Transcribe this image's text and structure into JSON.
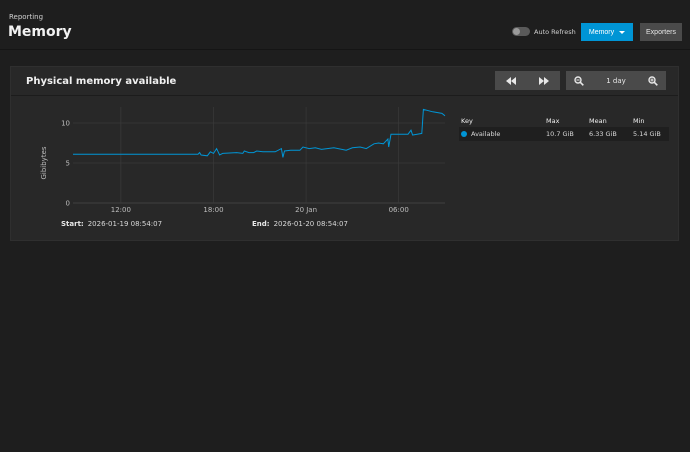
{
  "header": {
    "breadcrumb": "Reporting",
    "title": "Memory",
    "auto_refresh_label": "Auto Refresh",
    "auto_refresh_on": false,
    "memory_button": "Memory",
    "exporters_button": "Exporters"
  },
  "card": {
    "title": "Physical memory available",
    "prev_icon": "rewind-icon",
    "next_icon": "fast-forward-icon",
    "zoom_out_icon": "zoom-out-icon",
    "zoom_in_icon": "zoom-in-icon",
    "range_label": "1 day",
    "start_label": "Start:",
    "start_value": "2026-01-19 08:54:07",
    "end_label": "End:",
    "end_value": "2026-01-20 08:54:07"
  },
  "legend": {
    "headers": [
      "Key",
      "Max",
      "Mean",
      "Min"
    ],
    "rows": [
      {
        "key": "Available",
        "max": "10.7 GiB",
        "mean": "6.33 GiB",
        "min": "5.14 GiB",
        "color": "#0095d5"
      }
    ]
  },
  "colors": {
    "accent": "#0095d5",
    "background": "#1e1e1e",
    "card": "#282828"
  },
  "chart_data": {
    "type": "line",
    "ylabel": "Gibibytes",
    "ylim": [
      0,
      12
    ],
    "yticks": [
      "0",
      "5",
      "10"
    ],
    "xticks": [
      "12:00",
      "18:00",
      "20 Jan",
      "06:00"
    ],
    "xlim_hours": [
      8.9,
      33.0
    ],
    "grid": true,
    "series": [
      {
        "name": "Available",
        "color": "#0095d5",
        "points": [
          [
            8.9,
            6.1
          ],
          [
            11.0,
            6.1
          ],
          [
            14.0,
            6.1
          ],
          [
            16.5,
            6.1
          ],
          [
            17.0,
            6.1
          ],
          [
            17.1,
            6.3
          ],
          [
            17.2,
            6.0
          ],
          [
            17.6,
            5.9
          ],
          [
            17.8,
            6.4
          ],
          [
            18.0,
            6.2
          ],
          [
            18.2,
            6.8
          ],
          [
            18.4,
            6.0
          ],
          [
            18.6,
            6.2
          ],
          [
            19.5,
            6.3
          ],
          [
            19.9,
            6.2
          ],
          [
            20.0,
            6.5
          ],
          [
            20.3,
            6.3
          ],
          [
            20.6,
            6.3
          ],
          [
            20.8,
            6.5
          ],
          [
            21.2,
            6.4
          ],
          [
            22.0,
            6.4
          ],
          [
            22.4,
            6.8
          ],
          [
            22.5,
            5.7
          ],
          [
            22.6,
            6.5
          ],
          [
            23.0,
            6.6
          ],
          [
            23.6,
            6.6
          ],
          [
            23.8,
            7.0
          ],
          [
            24.2,
            6.8
          ],
          [
            24.6,
            6.9
          ],
          [
            25.0,
            6.7
          ],
          [
            25.8,
            6.9
          ],
          [
            26.6,
            6.6
          ],
          [
            27.0,
            6.9
          ],
          [
            27.5,
            7.0
          ],
          [
            27.9,
            6.8
          ],
          [
            28.4,
            7.4
          ],
          [
            28.7,
            7.5
          ],
          [
            29.0,
            7.4
          ],
          [
            29.3,
            8.0
          ],
          [
            29.35,
            7.0
          ],
          [
            29.5,
            8.6
          ],
          [
            30.6,
            8.6
          ],
          [
            30.8,
            9.1
          ],
          [
            30.9,
            8.5
          ],
          [
            31.2,
            8.6
          ],
          [
            31.5,
            8.7
          ],
          [
            31.6,
            11.7
          ],
          [
            32.2,
            11.4
          ],
          [
            32.8,
            11.2
          ],
          [
            33.0,
            10.9
          ]
        ]
      }
    ]
  }
}
